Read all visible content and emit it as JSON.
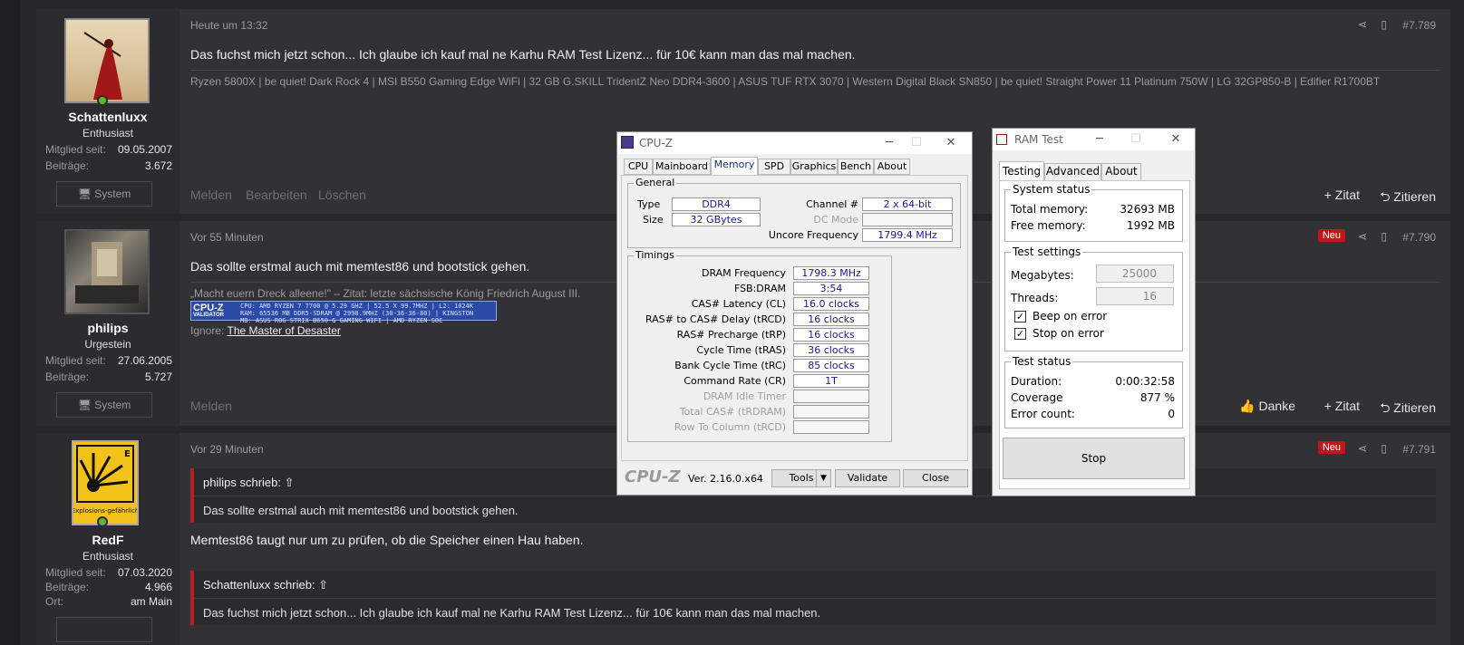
{
  "posts": [
    {
      "username": "Schattenluxx",
      "rank": "Enthusiast",
      "stats": [
        {
          "k": "Mitglied seit:",
          "v": "09.05.2007"
        },
        {
          "k": "Beiträge:",
          "v": "3.672"
        }
      ],
      "system_label": "System",
      "date": "Heute um 13:32",
      "postnum": "#7.789",
      "message": "Das fuchst mich jetzt schon... Ich glaube ich kauf mal ne Karhu RAM Test Lizenz... für 10€ kann man das mal machen.",
      "signature": "Ryzen 5800X | be quiet! Dark Rock 4 | MSI B550 Gaming Edge WiFi | 32 GB G.SKILL TridentZ Neo DDR4-3600 | ASUS TUF RTX 3070 | Western Digital Black SN850 | be quiet! Straight Power 11 Platinum 750W | LG 32GP850-B | Edifier R1700BT",
      "actions_left": [
        "Melden",
        "Bearbeiten",
        "Löschen"
      ],
      "actions_right": [
        "+ Zitat",
        "⮌ Zitieren"
      ]
    },
    {
      "username": "philips",
      "rank": "Urgestein",
      "stats": [
        {
          "k": "Mitglied seit:",
          "v": "27.06.2005"
        },
        {
          "k": "Beiträge:",
          "v": "5.727"
        }
      ],
      "system_label": "System",
      "date": "Vor 55 Minuten",
      "badge": "Neu",
      "postnum": "#7.790",
      "message": "Das sollte erstmal auch mit memtest86 und bootstick gehen.",
      "signature": "„Macht euern Dreck alleene!\" – Zitat: letzte sächsische König Friedrich August III.",
      "validator_logo": "CPU-Z",
      "validator_sub": "VALIDATOR",
      "validator_lines": [
        "CPU: AMD RYZEN 7 7700 @ 5.29 GHZ | 52.5 X 99.7MHZ | L2: 1024K",
        "RAM: 65536 MB DDR5-SDRAM @ 2998.9MHZ (30-36-36-80) | KINGSTON",
        "MB: ASUS ROG STRIX B650-G GAMING WIFI | AMD RYZEN SOC"
      ],
      "ignore_label": "Ignore:",
      "ignore_link": "The Master of Desaster",
      "actions_left": [
        "Melden"
      ],
      "actions_right": [
        "👍 Danke",
        "+ Zitat",
        "⮌ Zitieren"
      ]
    },
    {
      "username": "RedF",
      "rank": "Enthusiast",
      "stats": [
        {
          "k": "Mitglied seit:",
          "v": "07.03.2020"
        },
        {
          "k": "Beiträge:",
          "v": "4.966"
        },
        {
          "k": "Ort:",
          "v": "am Main"
        }
      ],
      "avatar_text": "Explosions-gefährlich",
      "date": "Vor 29 Minuten",
      "badge": "Neu",
      "postnum": "#7.791",
      "quote1_header": "philips schrieb: ⇧",
      "quote1_body": "Das sollte erstmal auch mit memtest86 und bootstick gehen.",
      "message": "Memtest86 taugt nur um zu prüfen, ob die Speicher einen Hau haben.",
      "quote2_header": "Schattenluxx schrieb: ⇧",
      "quote2_body": "Das fuchst mich jetzt schon... Ich glaube ich kauf mal ne Karhu RAM Test Lizenz... für 10€ kann man das mal machen."
    }
  ],
  "cpuz": {
    "title": "CPU-Z",
    "tabs": [
      "CPU",
      "Mainboard",
      "Memory",
      "SPD",
      "Graphics",
      "Bench",
      "About"
    ],
    "active_tab": "Memory",
    "general_title": "General",
    "type_label": "Type",
    "type_value": "DDR4",
    "size_label": "Size",
    "size_value": "32 GBytes",
    "channel_label": "Channel #",
    "channel_value": "2 x 64-bit",
    "dcmode_label": "DC Mode",
    "dcmode_value": "",
    "uncore_label": "Uncore Frequency",
    "uncore_value": "1799.4 MHz",
    "timings_title": "Timings",
    "timings": [
      {
        "label": "DRAM Frequency",
        "value": "1798.3 MHz"
      },
      {
        "label": "FSB:DRAM",
        "value": "3:54"
      },
      {
        "label": "CAS# Latency (CL)",
        "value": "16.0 clocks"
      },
      {
        "label": "RAS# to CAS# Delay (tRCD)",
        "value": "16 clocks"
      },
      {
        "label": "RAS# Precharge (tRP)",
        "value": "16 clocks"
      },
      {
        "label": "Cycle Time (tRAS)",
        "value": "36 clocks"
      },
      {
        "label": "Bank Cycle Time (tRC)",
        "value": "85 clocks"
      },
      {
        "label": "Command Rate (CR)",
        "value": "1T"
      },
      {
        "label": "DRAM Idle Timer",
        "value": ""
      },
      {
        "label": "Total CAS# (tRDRAM)",
        "value": ""
      },
      {
        "label": "Row To Column (tRCD)",
        "value": ""
      }
    ],
    "brand": "CPU-Z",
    "version": "Ver. 2.16.0.x64",
    "tools_label": "Tools",
    "validate_label": "Validate",
    "close_label": "Close"
  },
  "ramtest": {
    "title": "RAM Test",
    "tabs": [
      "Testing",
      "Advanced",
      "About"
    ],
    "active_tab": "Testing",
    "system_status_title": "System status",
    "total_memory_label": "Total memory:",
    "total_memory_value": "32693 MB",
    "free_memory_label": "Free memory:",
    "free_memory_value": "1992 MB",
    "test_settings_title": "Test settings",
    "megabytes_label": "Megabytes:",
    "megabytes_value": "25000",
    "threads_label": "Threads:",
    "threads_value": "16",
    "beep_label": "Beep on error",
    "stop_on_error_label": "Stop on error",
    "test_status_title": "Test status",
    "duration_label": "Duration:",
    "duration_value": "0:00:32:58",
    "coverage_label": "Coverage",
    "coverage_value": "877 %",
    "errors_label": "Error count:",
    "errors_value": "0",
    "stop_label": "Stop"
  },
  "colors": {
    "accent_red": "#c0171b",
    "online": "#63b32e",
    "cpuz_value": "#1a1a9a"
  }
}
